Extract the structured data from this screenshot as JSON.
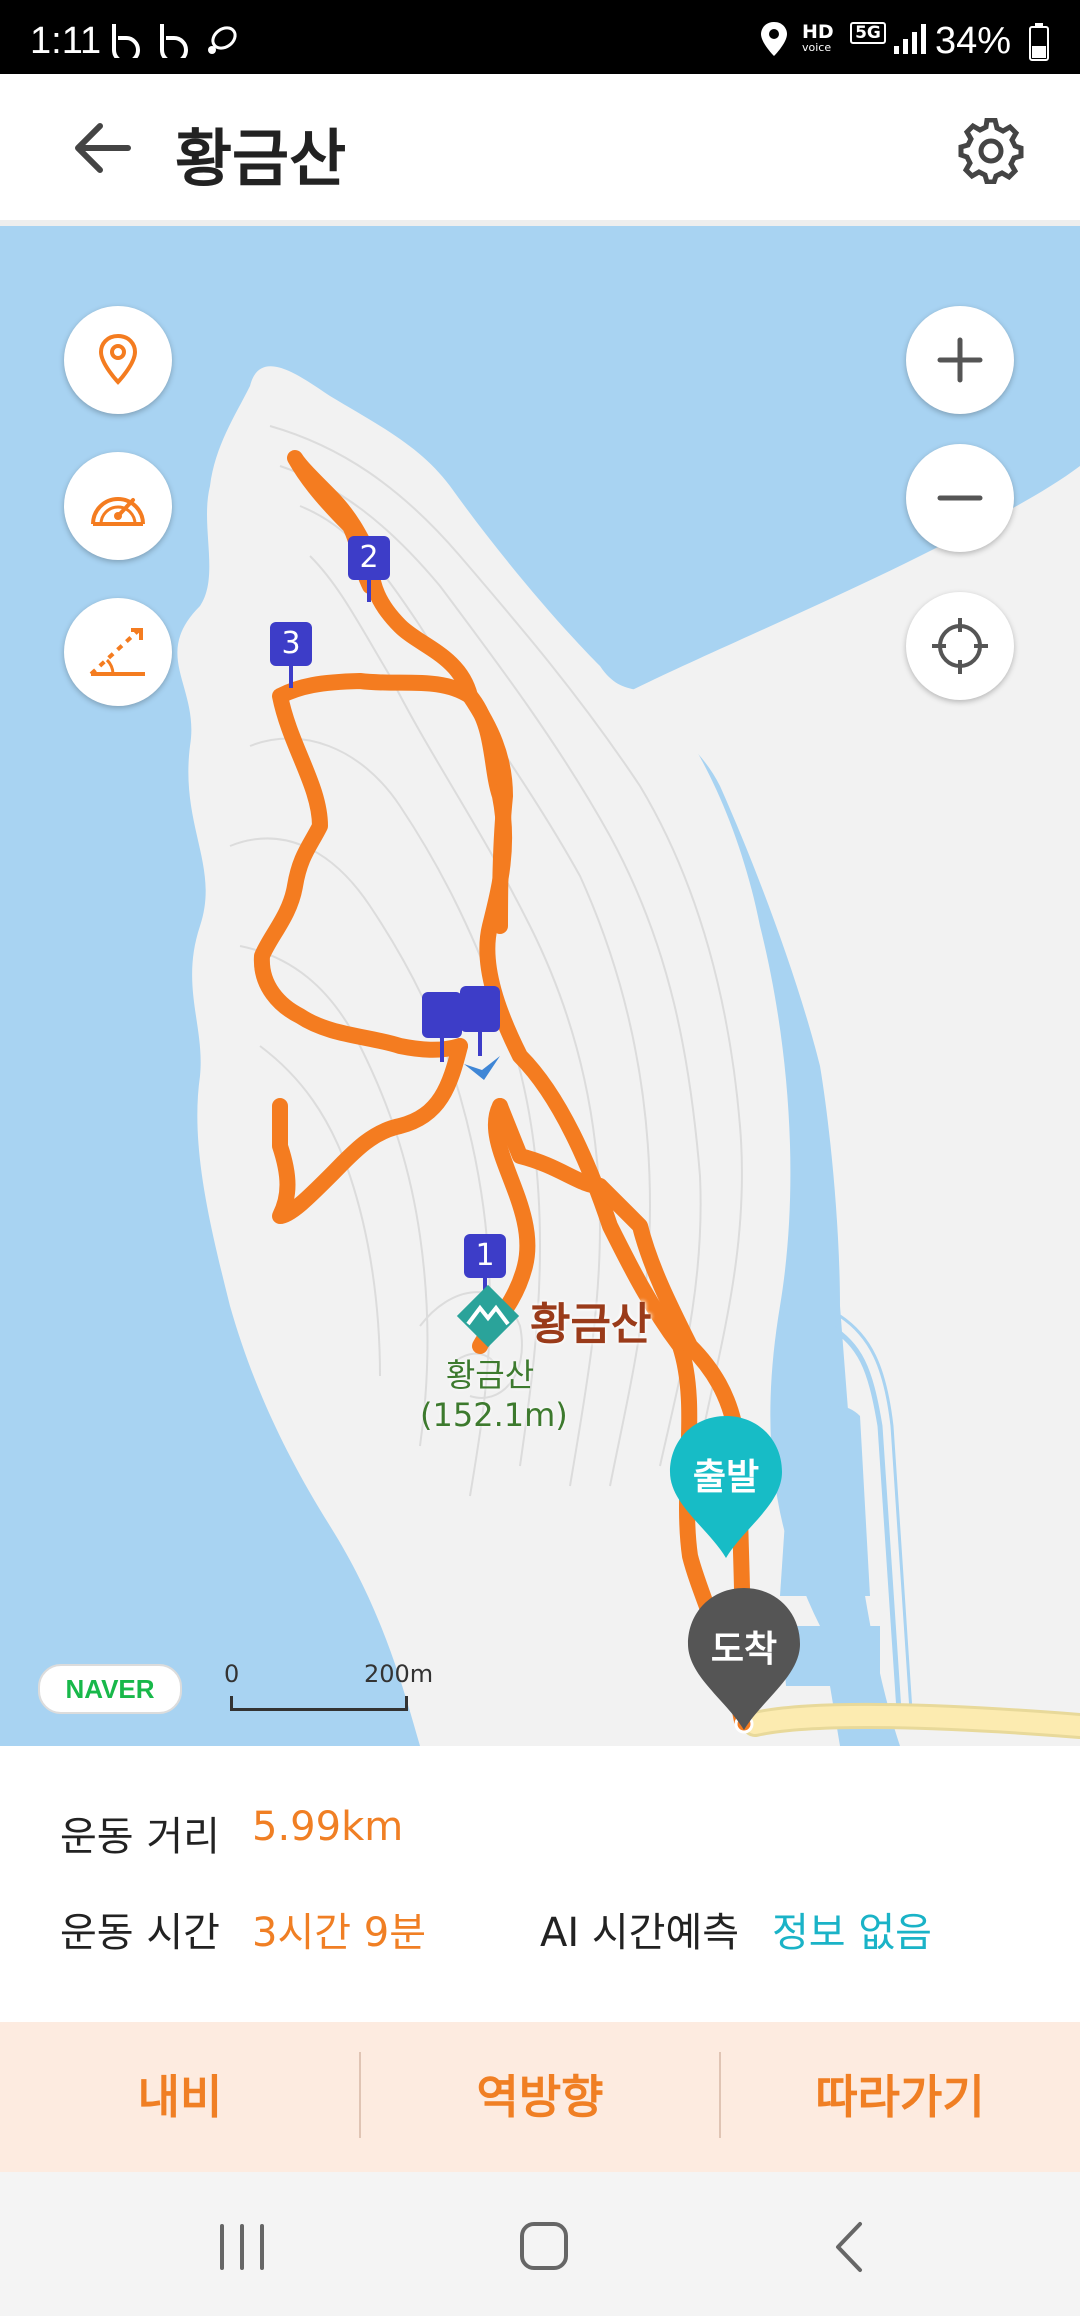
{
  "status_bar": {
    "time": "1:11",
    "network": "5G",
    "hd_label": "HD",
    "voice_label": "voice",
    "battery": "34%",
    "icons": [
      "b-app-icon",
      "b-app-icon",
      "activity-icon",
      "location-icon",
      "hd-voice-icon",
      "5g-icon",
      "signal-icon",
      "battery-icon"
    ]
  },
  "app_bar": {
    "title": "황금산",
    "back_icon": "arrow-left-icon",
    "settings_icon": "gear-icon"
  },
  "map": {
    "left_controls": [
      "location-pin-icon",
      "speedometer-icon",
      "elevation-icon"
    ],
    "right_controls": [
      "plus-icon",
      "minus-icon",
      "crosshair-icon"
    ],
    "waypoints": [
      "1",
      "2",
      "3"
    ],
    "peak_name": "황금산",
    "peak_label_line1": "황금산",
    "peak_label_line2": "(152.1m)",
    "start_label": "출발",
    "end_label": "도착",
    "logo": "NAVER",
    "scale_start": "0",
    "scale_end": "200m",
    "route_color": "#f47c20",
    "water_color": "#a8d3f2",
    "start_color": "#17bcc6",
    "end_color": "#555555",
    "waypoint_color": "#3d3dc8"
  },
  "info": {
    "distance_label": "운동 거리",
    "distance_value": "5.99km",
    "time_label": "운동 시간",
    "time_value": "3시간 9분",
    "ai_label": "AI 시간예측",
    "ai_value": "정보 없음"
  },
  "actions": {
    "nav": "내비",
    "reverse": "역방향",
    "follow": "따라가기"
  },
  "nav_bar": {
    "icons": [
      "recent-apps-icon",
      "home-icon",
      "back-icon"
    ]
  }
}
